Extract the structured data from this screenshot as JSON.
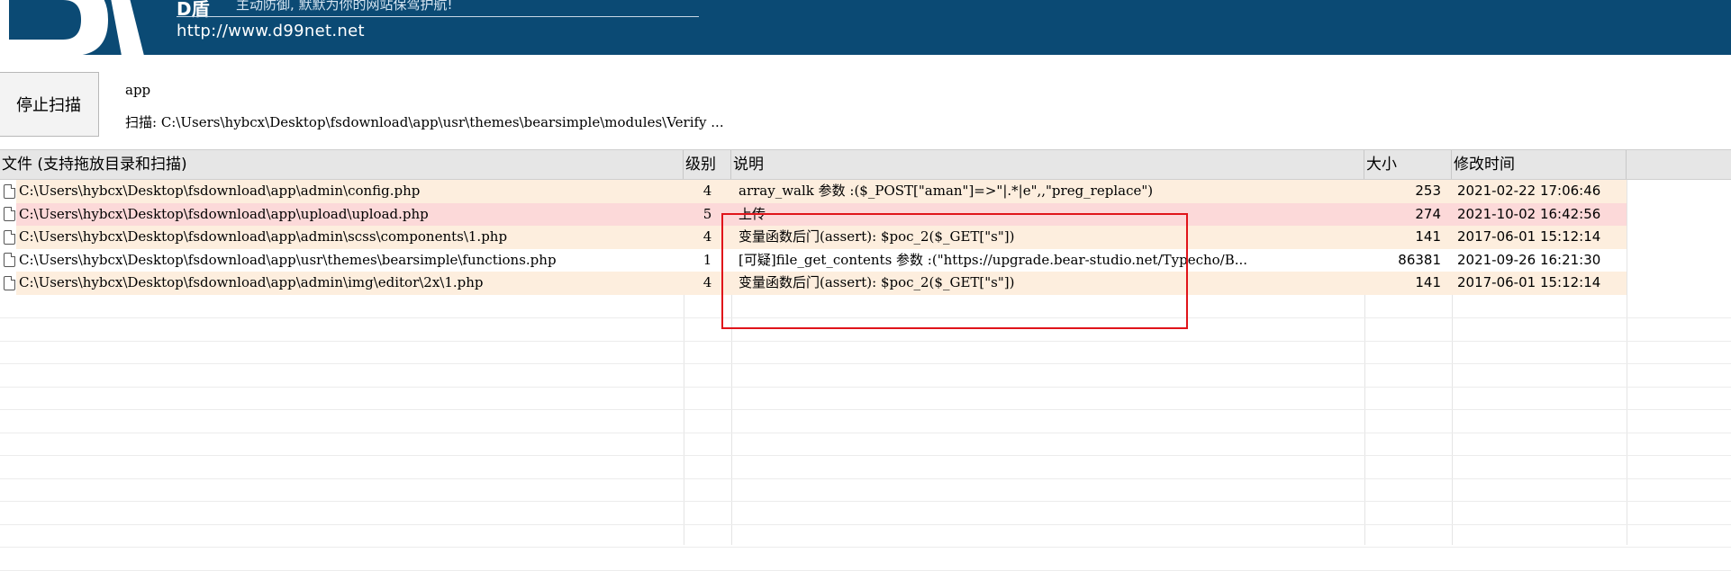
{
  "banner": {
    "slogan": "主动防御, 默默为你的网站保驾护航!",
    "url": "http://www.d99net.net"
  },
  "toolbar": {
    "stop_label": "停止扫描",
    "scan_target": "app",
    "scan_status": "扫描: C:\\Users\\hybcx\\Desktop\\fsdownload\\app\\usr\\themes\\bearsimple\\modules\\Verify ..."
  },
  "table": {
    "headers": {
      "file": "文件 (支持拖放目录和扫描)",
      "level": "级别",
      "desc": "说明",
      "size": "大小",
      "time": "修改时间"
    },
    "rows": [
      {
        "file": "C:\\Users\\hybcx\\Desktop\\fsdownload\\app\\admin\\config.php",
        "level": "4",
        "desc": "array_walk 参数 :($_POST[\"aman\"]=>\"|.*|e\",,\"preg_replace\")",
        "size": "253",
        "time": "2021-02-22 17:06:46",
        "tint": "#fdeede"
      },
      {
        "file": "C:\\Users\\hybcx\\Desktop\\fsdownload\\app\\upload\\upload.php",
        "level": "5",
        "desc": "上传",
        "size": "274",
        "time": "2021-10-02 16:42:56",
        "tint": "#fcd9d9"
      },
      {
        "file": "C:\\Users\\hybcx\\Desktop\\fsdownload\\app\\admin\\scss\\components\\1.php",
        "level": "4",
        "desc": "变量函数后门(assert): $poc_2($_GET[\"s\"])",
        "size": "141",
        "time": "2017-06-01 15:12:14",
        "tint": "#fdeede"
      },
      {
        "file": "C:\\Users\\hybcx\\Desktop\\fsdownload\\app\\usr\\themes\\bearsimple\\functions.php",
        "level": "1",
        "desc": "[可疑]file_get_contents 参数 :(\"https://upgrade.bear-studio.net/Typecho/B...",
        "size": "86381",
        "time": "2021-09-26 16:21:30",
        "tint": "#ffffff"
      },
      {
        "file": "C:\\Users\\hybcx\\Desktop\\fsdownload\\app\\admin\\img\\editor\\2x\\1.php",
        "level": "4",
        "desc": "变量函数后门(assert): $poc_2($_GET[\"s\"])",
        "size": "141",
        "time": "2017-06-01 15:12:14",
        "tint": "#fdeede"
      }
    ]
  }
}
